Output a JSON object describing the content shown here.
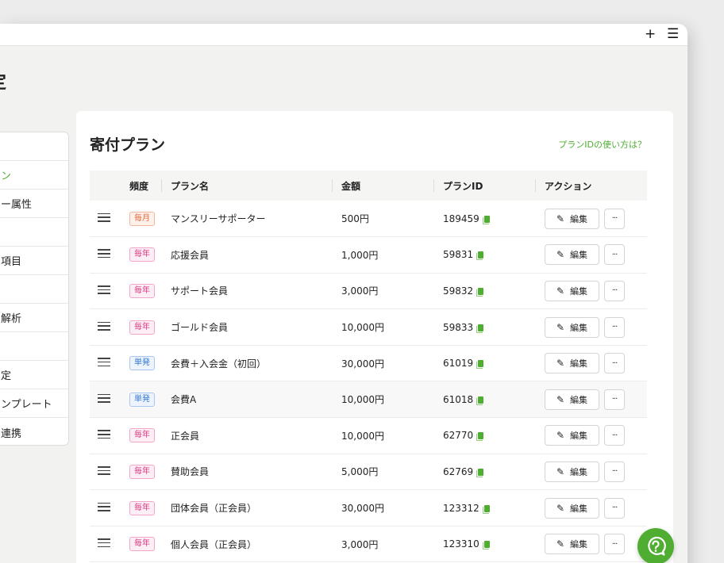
{
  "topbar": {
    "plus_icon": "+",
    "menu_icon": "☰"
  },
  "page": {
    "title_fragment": "定"
  },
  "sidebar": {
    "items": [
      {
        "label": ""
      },
      {
        "label": "ン",
        "active": true
      },
      {
        "label": "ー属性"
      },
      {
        "label": ""
      },
      {
        "label": "項目"
      },
      {
        "label": ""
      },
      {
        "label": "解析"
      },
      {
        "label": ""
      },
      {
        "label": "定"
      },
      {
        "label": "ンプレート"
      },
      {
        "label": "連携"
      }
    ]
  },
  "main": {
    "title": "寄付プラン",
    "help_link": "プランIDの使い方は？",
    "columns": [
      "",
      "頻度",
      "プラン名",
      "金額",
      "プランID",
      "アクション"
    ],
    "edit_label": "編集",
    "more_label": "···",
    "rows": [
      {
        "freq": "毎月",
        "freq_type": "monthly",
        "name": "マンスリーサポーター",
        "amount": "500円",
        "plan_id": "189459"
      },
      {
        "freq": "毎年",
        "freq_type": "yearly",
        "name": "応援会員",
        "amount": "1,000円",
        "plan_id": "59831"
      },
      {
        "freq": "毎年",
        "freq_type": "yearly",
        "name": "サポート会員",
        "amount": "3,000円",
        "plan_id": "59832"
      },
      {
        "freq": "毎年",
        "freq_type": "yearly",
        "name": "ゴールド会員",
        "amount": "10,000円",
        "plan_id": "59833"
      },
      {
        "freq": "単発",
        "freq_type": "single",
        "name": "会費＋入会金（初回）",
        "amount": "30,000円",
        "plan_id": "61019"
      },
      {
        "freq": "単発",
        "freq_type": "single",
        "name": "会費A",
        "amount": "10,000円",
        "plan_id": "61018",
        "highlight": true
      },
      {
        "freq": "毎年",
        "freq_type": "yearly",
        "name": "正会員",
        "amount": "10,000円",
        "plan_id": "62770"
      },
      {
        "freq": "毎年",
        "freq_type": "yearly",
        "name": "賛助会員",
        "amount": "5,000円",
        "plan_id": "62769"
      },
      {
        "freq": "毎年",
        "freq_type": "yearly",
        "name": "団体会員（正会員）",
        "amount": "30,000円",
        "plan_id": "123312"
      },
      {
        "freq": "毎年",
        "freq_type": "yearly",
        "name": "個人会員（正会員）",
        "amount": "3,000円",
        "plan_id": "123310"
      }
    ]
  },
  "colors": {
    "accent": "#4fae32",
    "monthly": "#e0683a",
    "yearly": "#d93b86",
    "single": "#3a7bd5"
  }
}
